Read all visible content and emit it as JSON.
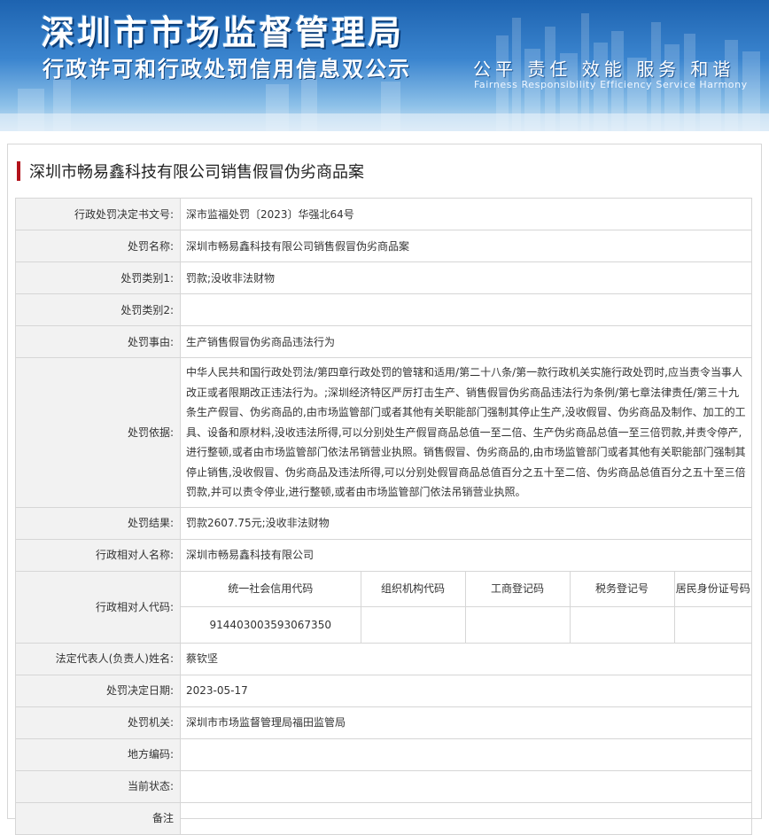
{
  "banner": {
    "title": "深圳市市场监督管理局",
    "subtitle": "行政许可和行政处罚信用信息双公示",
    "motto_cn": "公平 责任 效能 服务 和谐",
    "motto_en": "Fairness Responsibility Efficiency Service Harmony"
  },
  "case": {
    "title": "深圳市畅易鑫科技有限公司销售假冒伪劣商品案",
    "rows": {
      "doc_no": {
        "label": "行政处罚决定书文号:",
        "value": "深市监福处罚〔2023〕华强北64号"
      },
      "name": {
        "label": "处罚名称:",
        "value": "深圳市畅易鑫科技有限公司销售假冒伪劣商品案"
      },
      "type1": {
        "label": "处罚类别1:",
        "value": "罚款;没收非法财物"
      },
      "type2": {
        "label": "处罚类别2:",
        "value": ""
      },
      "reason": {
        "label": "处罚事由:",
        "value": "生产销售假冒伪劣商品违法行为"
      },
      "basis": {
        "label": "处罚依据:",
        "value": "中华人民共和国行政处罚法/第四章行政处罚的管辖和适用/第二十八条/第一款行政机关实施行政处罚时,应当责令当事人改正或者限期改正违法行为。;深圳经济特区严厉打击生产、销售假冒伪劣商品违法行为条例/第七章法律责任/第三十九条生产假冒、伪劣商品的,由市场监管部门或者其他有关职能部门强制其停止生产,没收假冒、伪劣商品及制作、加工的工具、设备和原材料,没收违法所得,可以分别处生产假冒商品总值一至二倍、生产伪劣商品总值一至三倍罚款,并责令停产,进行整顿,或者由市场监管部门依法吊销营业执照。销售假冒、伪劣商品的,由市场监管部门或者其他有关职能部门强制其停止销售,没收假冒、伪劣商品及违法所得,可以分别处假冒商品总值百分之五十至二倍、伪劣商品总值百分之五十至三倍罚款,并可以责令停业,进行整顿,或者由市场监管部门依法吊销营业执照。"
      },
      "result": {
        "label": "处罚结果:",
        "value": "罚款2607.75元;没收非法财物"
      },
      "party": {
        "label": "行政相对人名称:",
        "value": "深圳市畅易鑫科技有限公司"
      },
      "party_code": {
        "label": "行政相对人代码:",
        "headers": [
          "统一社会信用代码",
          "组织机构代码",
          "工商登记码",
          "税务登记号",
          "居民身份证号码"
        ],
        "values": [
          "914403003593067350",
          "",
          "",
          "",
          ""
        ]
      },
      "legal_rep": {
        "label": "法定代表人(负责人)姓名:",
        "value": "蔡钦坚"
      },
      "date": {
        "label": "处罚决定日期:",
        "value": "2023-05-17"
      },
      "authority": {
        "label": "处罚机关:",
        "value": "深圳市市场监督管理局福田监管局"
      },
      "area_code": {
        "label": "地方编码:",
        "value": ""
      },
      "status": {
        "label": "当前状态:",
        "value": ""
      },
      "remark": {
        "label": "备注",
        "value": ""
      }
    }
  },
  "colors": {
    "accent_bar": "#b2121b",
    "label_bg": "#f2f2f2",
    "banner_blue": "#2a74c2"
  }
}
